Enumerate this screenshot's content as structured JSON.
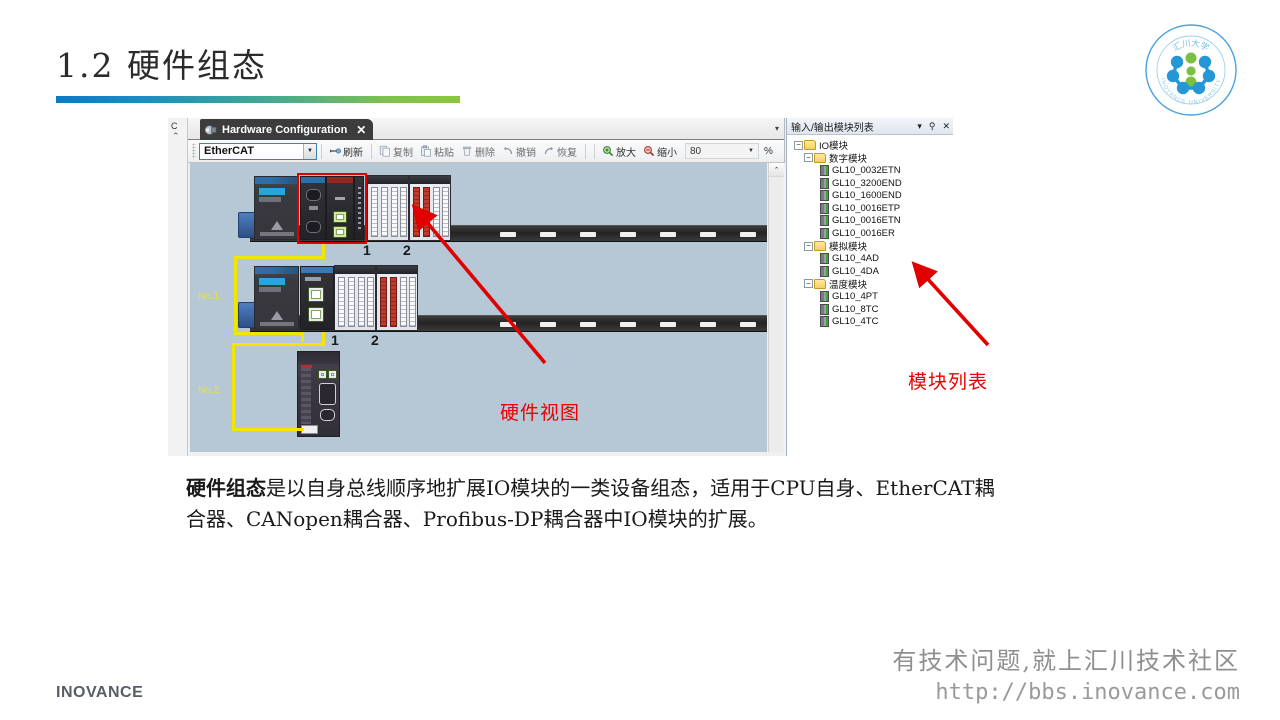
{
  "slide": {
    "title": "1.2 硬件组态"
  },
  "logo": {
    "university_cn": "汇川大学",
    "university_en": "INOVANCE UNIVERSITY"
  },
  "app": {
    "tab": {
      "label": "Hardware Configuration",
      "close": "✕",
      "icon": "hardware-icon"
    },
    "tab_overflow": "▾",
    "toolbar": {
      "device_combo_value": "EtherCAT",
      "device_combo_arrow": "▼",
      "buttons": [
        {
          "label": "刷新",
          "icon": "refresh-icon",
          "enabled": true
        },
        {
          "label": "复制",
          "icon": "copy-icon",
          "enabled": false
        },
        {
          "label": "粘贴",
          "icon": "paste-icon",
          "enabled": false
        },
        {
          "label": "删除",
          "icon": "delete-icon",
          "enabled": false
        },
        {
          "label": "撤销",
          "icon": "undo-icon",
          "enabled": false
        },
        {
          "label": "恢复",
          "icon": "redo-icon",
          "enabled": false
        },
        {
          "label": "放大",
          "icon": "zoom-in-icon",
          "enabled": true
        },
        {
          "label": "缩小",
          "icon": "zoom-out-icon",
          "enabled": true
        }
      ],
      "zoom_value": "80",
      "zoom_arrow": "▼",
      "zoom_unit": "%"
    },
    "canvas": {
      "node_labels": [
        "No.1",
        "No.2"
      ],
      "slot_numbers_row1": [
        "1",
        "2"
      ],
      "slot_numbers_row2": [
        "1",
        "2"
      ],
      "scroll_up": "⌃",
      "background_color": "#b6c7d6",
      "selection_color": "#e00000",
      "link_color": "#f2e500"
    },
    "edge_strip": {
      "label": "C",
      "arrow": "⌃"
    },
    "dock": {
      "title": "输入/输出模块列表",
      "dropdown_icon": "▾",
      "pin_icon": "⚲",
      "close_icon": "✕",
      "tree": [
        {
          "label": "IO模块",
          "level": 1,
          "type": "folder",
          "expander": "−"
        },
        {
          "label": "数字模块",
          "level": 2,
          "type": "folder",
          "expander": "−"
        },
        {
          "label": "GL10_0032ETN",
          "level": 3,
          "type": "module"
        },
        {
          "label": "GL10_3200END",
          "level": 3,
          "type": "module"
        },
        {
          "label": "GL10_1600END",
          "level": 3,
          "type": "module"
        },
        {
          "label": "GL10_0016ETP",
          "level": 3,
          "type": "module"
        },
        {
          "label": "GL10_0016ETN",
          "level": 3,
          "type": "module"
        },
        {
          "label": "GL10_0016ER",
          "level": 3,
          "type": "module"
        },
        {
          "label": "模拟模块",
          "level": 2,
          "type": "folder",
          "expander": "−"
        },
        {
          "label": "GL10_4AD",
          "level": 3,
          "type": "module"
        },
        {
          "label": "GL10_4DA",
          "level": 3,
          "type": "module"
        },
        {
          "label": "温度模块",
          "level": 2,
          "type": "folder",
          "expander": "−"
        },
        {
          "label": "GL10_4PT",
          "level": 3,
          "type": "module"
        },
        {
          "label": "GL10_8TC",
          "level": 3,
          "type": "module"
        },
        {
          "label": "GL10_4TC",
          "level": 3,
          "type": "module"
        }
      ]
    }
  },
  "annotations": {
    "hardware_view": "硬件视图",
    "module_list": "模块列表",
    "color": "#ee0000"
  },
  "body": {
    "lead": "硬件组态",
    "rest": "是以自身总线顺序地扩展IO模块的一类设备组态，适用于CPU自身、EtherCAT耦合器、CANopen耦合器、Profibus-DP耦合器中IO模块的扩展。"
  },
  "footer": {
    "brand": "INOVANCE",
    "tagline": "有技术问题,就上汇川技术社区",
    "url": "http://bbs.inovance.com"
  }
}
